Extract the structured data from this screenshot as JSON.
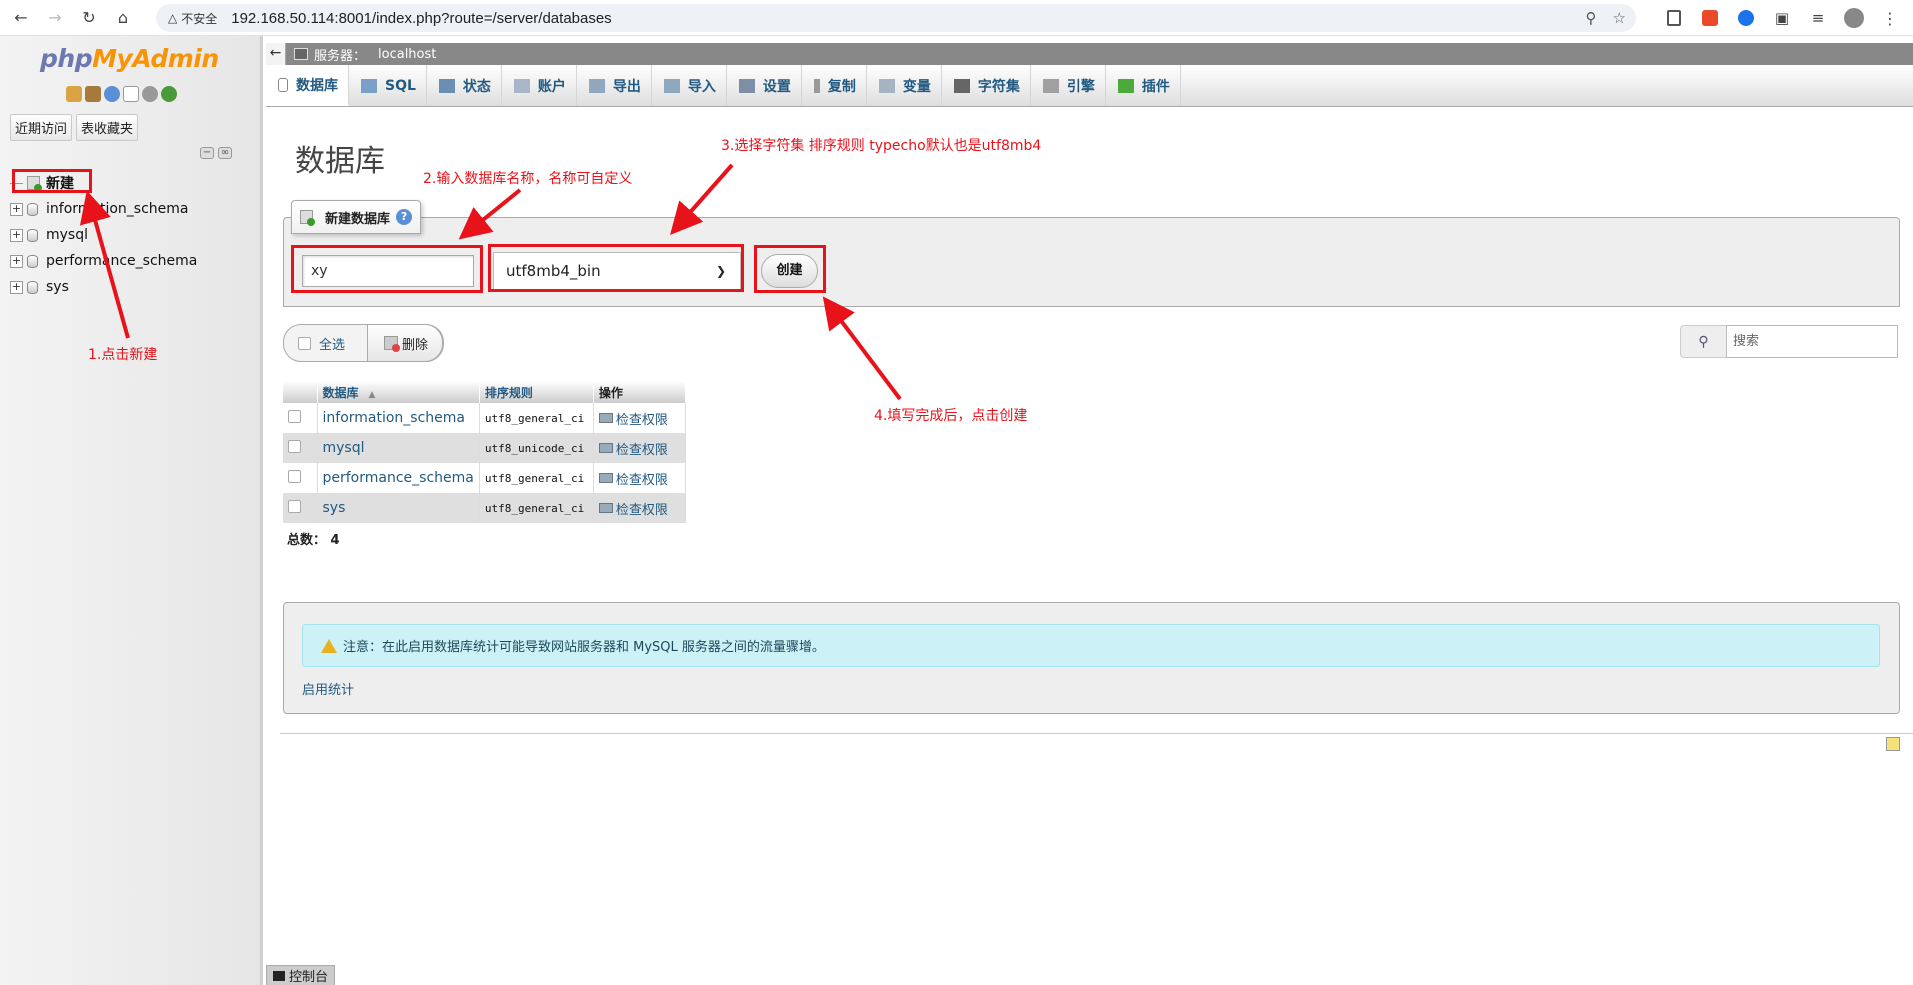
{
  "browser": {
    "security_label": "不安全",
    "url": "192.168.50.114:8001/index.php?route=/server/databases"
  },
  "logo": {
    "part1": "php",
    "part2": "MyAdmin"
  },
  "nav": {
    "tabs": [
      "近期访问",
      "表收藏夹"
    ],
    "tree": [
      {
        "label": "新建",
        "is_new": true
      },
      {
        "label": "information_schema"
      },
      {
        "label": "mysql"
      },
      {
        "label": "performance_schema"
      },
      {
        "label": "sys"
      }
    ]
  },
  "breadcrumb": {
    "server_label": "服务器：",
    "server_name": "localhost"
  },
  "topmenu": {
    "items": [
      "数据库",
      "SQL",
      "状态",
      "账户",
      "导出",
      "导入",
      "设置",
      "复制",
      "变量",
      "字符集",
      "引擎",
      "插件"
    ],
    "active_index": 0
  },
  "page": {
    "title": "数据库",
    "create": {
      "legend": "新建数据库",
      "db_name_value": "xy",
      "collation_value": "utf8mb4_bin",
      "button_label": "创建"
    },
    "toolbar": {
      "select_all_label": "全选",
      "delete_label": "删除",
      "search_placeholder": "搜索"
    },
    "table": {
      "headers": [
        "数据库",
        "排序规则",
        "操作"
      ],
      "rows": [
        {
          "db": "information_schema",
          "collation": "utf8_general_ci",
          "action": "检查权限"
        },
        {
          "db": "mysql",
          "collation": "utf8_unicode_ci",
          "action": "检查权限"
        },
        {
          "db": "performance_schema",
          "collation": "utf8_general_ci",
          "action": "检查权限"
        },
        {
          "db": "sys",
          "collation": "utf8_general_ci",
          "action": "检查权限"
        }
      ],
      "total_label": "总数：",
      "total_value": "4"
    },
    "notice": {
      "text": "注意：在此启用数据库统计可能导致网站服务器和 MySQL 服务器之间的流量骤增。",
      "link": "启用统计"
    },
    "console_label": "控制台"
  },
  "annotations": {
    "step1": "1.点击新建",
    "step2": "2.输入数据库名称，名称可自定义",
    "step3": "3.选择字符集 排序规则  typecho默认也是utf8mb4",
    "step4": "4.填写完成后，点击创建",
    "color": "#e8121a"
  }
}
